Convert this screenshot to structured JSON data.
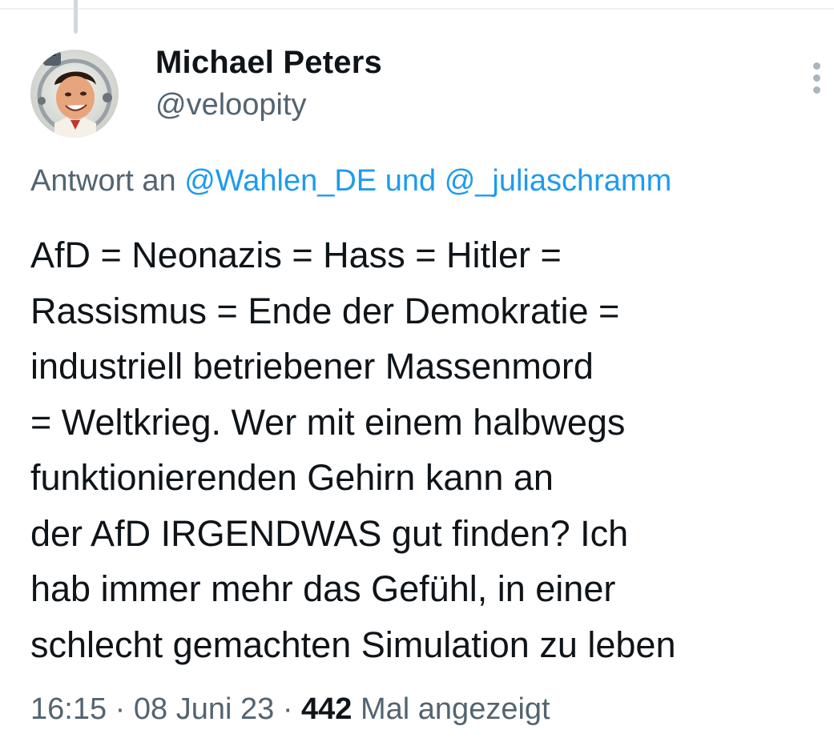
{
  "tweet": {
    "author_name": "Michael Peters",
    "author_handle": "@veloopity",
    "reply_prefix": "Antwort an",
    "reply_mention_1": "@Wahlen_DE",
    "reply_conjunction": "und",
    "reply_mention_2": "@_juliaschramm",
    "text_lines": [
      "AfD = Neonazis = Hass = Hitler =",
      "Rassismus = Ende der Demokratie =",
      "industriell betriebener Massenmord",
      "= Weltkrieg. Wer mit einem halbwegs",
      "funktionierenden Gehirn kann an",
      "der AfD IRGENDWAS gut finden? Ich",
      "hab immer mehr das Gefühl, in einer",
      "schlecht gemachten Simulation zu leben"
    ],
    "time": "16:15",
    "date": "08 Juni 23",
    "views_count": "442",
    "views_label": "Mal angezeigt",
    "separator": "·"
  },
  "icons": {
    "avatar": "avatar-illustration",
    "more": "more-options-icon"
  },
  "colors": {
    "link": "#1d9bf0",
    "secondary_text": "#536471",
    "primary_text": "#0f1419",
    "background": "#ffffff"
  }
}
